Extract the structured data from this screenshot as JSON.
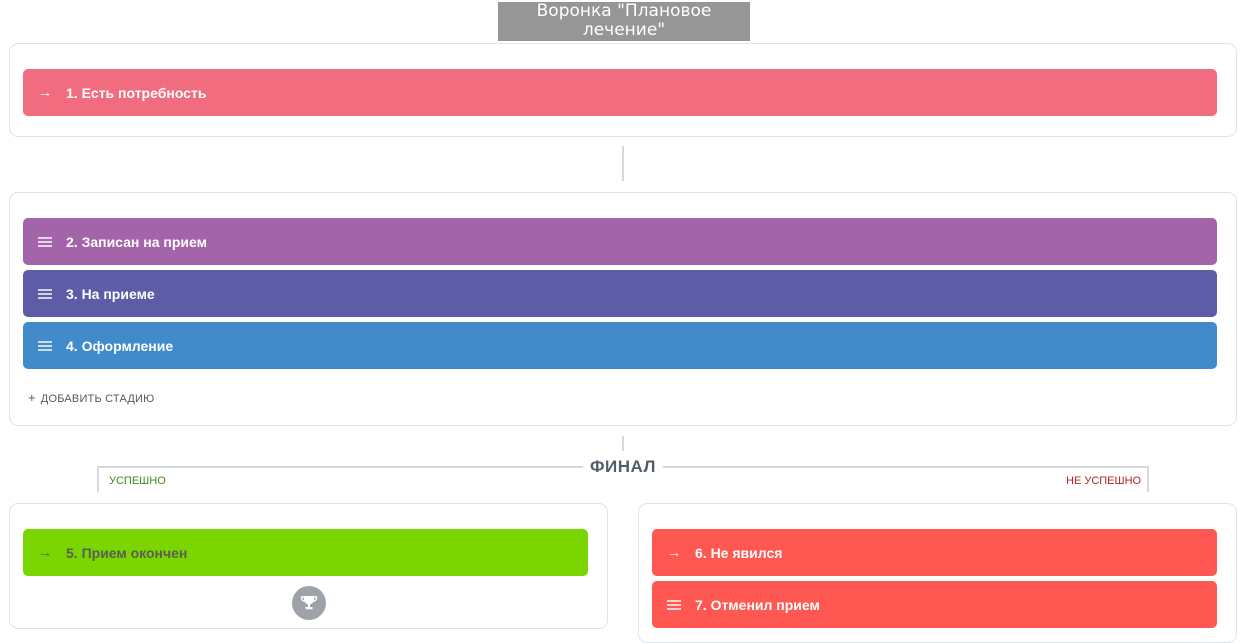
{
  "funnel": {
    "title": "Воронка \"Плановое лечение\""
  },
  "start_stages": [
    {
      "label": "1. Есть потребность",
      "icon": "arrow-right-icon",
      "color": "#f06c7e"
    }
  ],
  "process_stages": [
    {
      "label": "2. Записан на прием",
      "icon": "drag-handle-icon",
      "color": "#a464aa"
    },
    {
      "label": "3. На приеме",
      "icon": "drag-handle-icon",
      "color": "#5e5ca6"
    },
    {
      "label": "4. Оформление",
      "icon": "drag-handle-icon",
      "color": "#428bca"
    }
  ],
  "add_stage": {
    "plus": "+",
    "label": "ДОБАВИТЬ СТАДИЮ"
  },
  "final": {
    "label": "ФИНАЛ",
    "success_label": "УСПЕШНО",
    "fail_label": "НЕ УСПЕШНО",
    "success_stages": [
      {
        "label": "5. Прием окончен",
        "icon": "arrow-right-icon",
        "color": "#7bd500",
        "text_color": "#5a5f54"
      }
    ],
    "fail_stages": [
      {
        "label": "6. Не явился",
        "icon": "arrow-right-icon",
        "color": "#ff5752"
      },
      {
        "label": "7. Отменил прием",
        "icon": "drag-handle-icon",
        "color": "#ff5752"
      }
    ],
    "success_icon": "trophy-icon"
  },
  "icons": {
    "arrow": "→"
  }
}
